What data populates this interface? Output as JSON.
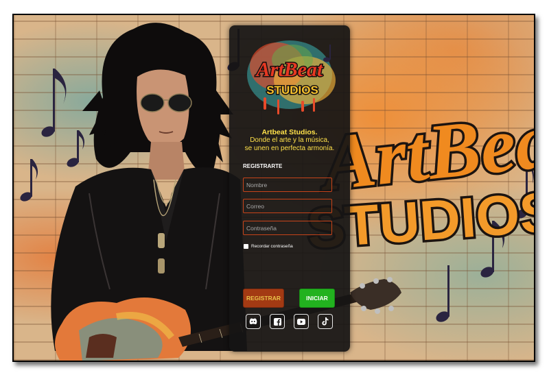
{
  "brand": {
    "logo_line1": "ArtBeat",
    "logo_line2": "STUDIOS",
    "name": "Artbeat Studios.",
    "tagline_line1": "Donde el arte y la música,",
    "tagline_line2": "se unen en perfecta armonía."
  },
  "form": {
    "title": "REGISTRARTE",
    "name_placeholder": "Nombre",
    "email_placeholder": "Correo",
    "password_placeholder": "Contraseña",
    "remember_label": "Recordar contraseña",
    "register_label": "REGISTRAR",
    "login_label": "INICIAR"
  },
  "social": [
    {
      "icon": "discord-icon"
    },
    {
      "icon": "facebook-icon"
    },
    {
      "icon": "youtube-icon"
    },
    {
      "icon": "tiktok-icon"
    }
  ],
  "graffiti": {
    "line1": "ArtBeat",
    "line2": "STUDIOS"
  },
  "colors": {
    "panel": "#161414",
    "accent_yellow": "#ffe14a",
    "field_border": "#c8441a",
    "register_button": "#a33a13",
    "login_button": "#22b21f"
  }
}
